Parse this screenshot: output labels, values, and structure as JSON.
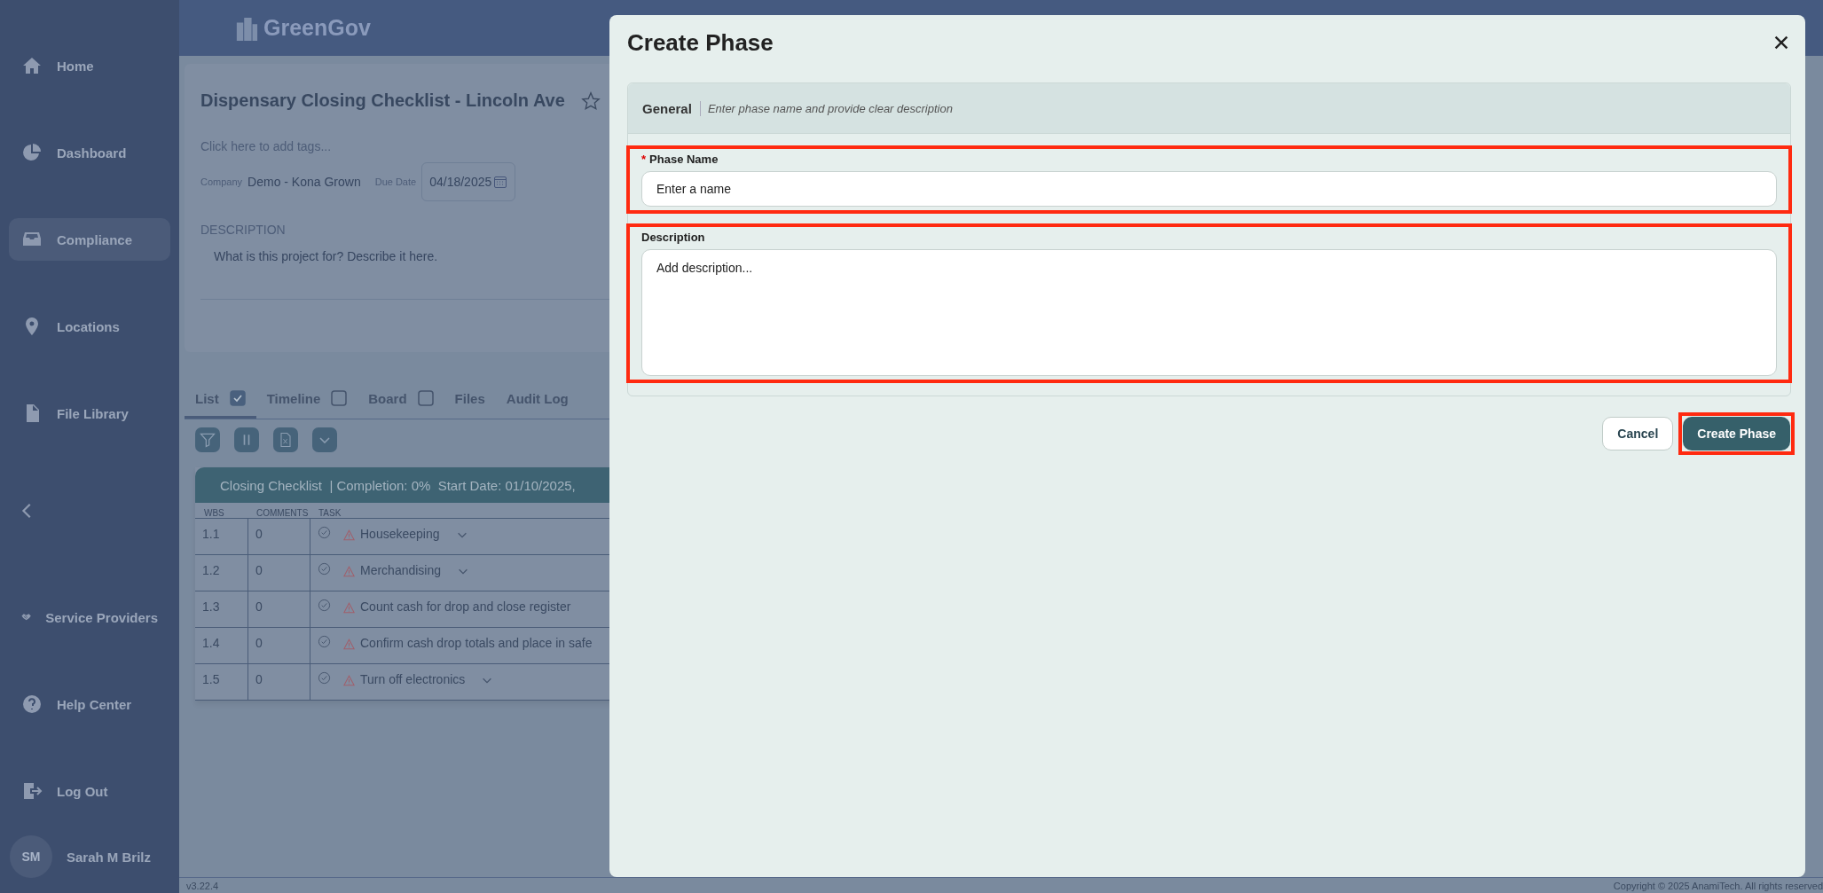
{
  "sidebar": {
    "top_items": [
      {
        "label": "Home",
        "selected": false
      },
      {
        "label": "Dashboard",
        "selected": false
      },
      {
        "label": "Compliance",
        "selected": true
      },
      {
        "label": "Locations",
        "selected": false
      },
      {
        "label": "File Library",
        "selected": false
      }
    ],
    "bottom_items": [
      {
        "label": "Service Providers",
        "selected": false
      },
      {
        "label": "Help Center",
        "selected": false
      },
      {
        "label": "Log Out",
        "selected": false
      }
    ],
    "user": {
      "initials": "SM",
      "name": "Sarah M Brilz"
    }
  },
  "header": {
    "logo": "GreenGov"
  },
  "project": {
    "title": "Dispensary Closing Checklist - Lincoln Ave",
    "tags_placeholder": "Click here to add tags...",
    "company_label": "Company",
    "company": "Demo - Kona Grown",
    "due_date_label": "Due Date",
    "due_date": "04/18/2025",
    "description_label": "DESCRIPTION",
    "description": "What is this project for? Describe it here."
  },
  "tabs": [
    {
      "label": "List",
      "kind": "toggle",
      "checked": true,
      "selected": true
    },
    {
      "label": "Timeline",
      "kind": "toggle",
      "checked": false,
      "selected": false
    },
    {
      "label": "Board",
      "kind": "toggle",
      "checked": false,
      "selected": false
    },
    {
      "label": "Files",
      "kind": "plain",
      "selected": false
    },
    {
      "label": "Audit Log",
      "kind": "plain",
      "selected": false
    }
  ],
  "table": {
    "banner": "Closing Checklist  | Completion: 0%  Start Date: 01/10/2025,",
    "columns": [
      "WBS",
      "COMMENTS",
      "TASK"
    ],
    "rows": [
      {
        "wbs": "1.1",
        "comments": "0",
        "task": "Housekeeping",
        "expandable": true
      },
      {
        "wbs": "1.2",
        "comments": "0",
        "task": "Merchandising",
        "expandable": true
      },
      {
        "wbs": "1.3",
        "comments": "0",
        "task": "Count cash for drop and close register",
        "expandable": false
      },
      {
        "wbs": "1.4",
        "comments": "0",
        "task": "Confirm cash drop totals and place in safe",
        "expandable": false
      },
      {
        "wbs": "1.5",
        "comments": "0",
        "task": "Turn off electronics",
        "expandable": true
      }
    ]
  },
  "footer": {
    "version": "v3.22.4",
    "copyright": "Copyright © 2025 AnamiTech. All rights reserved"
  },
  "modal": {
    "title": "Create Phase",
    "section": {
      "title": "General",
      "hint": "Enter phase name and provide clear description"
    },
    "fields": [
      {
        "kind": "input",
        "label": "Phase Name",
        "required_mark": "*",
        "placeholder": "Enter a name",
        "highlighted": true
      },
      {
        "kind": "textarea",
        "label": "Description",
        "placeholder": "Add description...",
        "highlighted": true
      }
    ],
    "buttons": [
      {
        "label": "Cancel",
        "kind": "secondary",
        "highlighted": false
      },
      {
        "label": "Create Phase",
        "kind": "primary",
        "highlighted": true
      }
    ]
  }
}
